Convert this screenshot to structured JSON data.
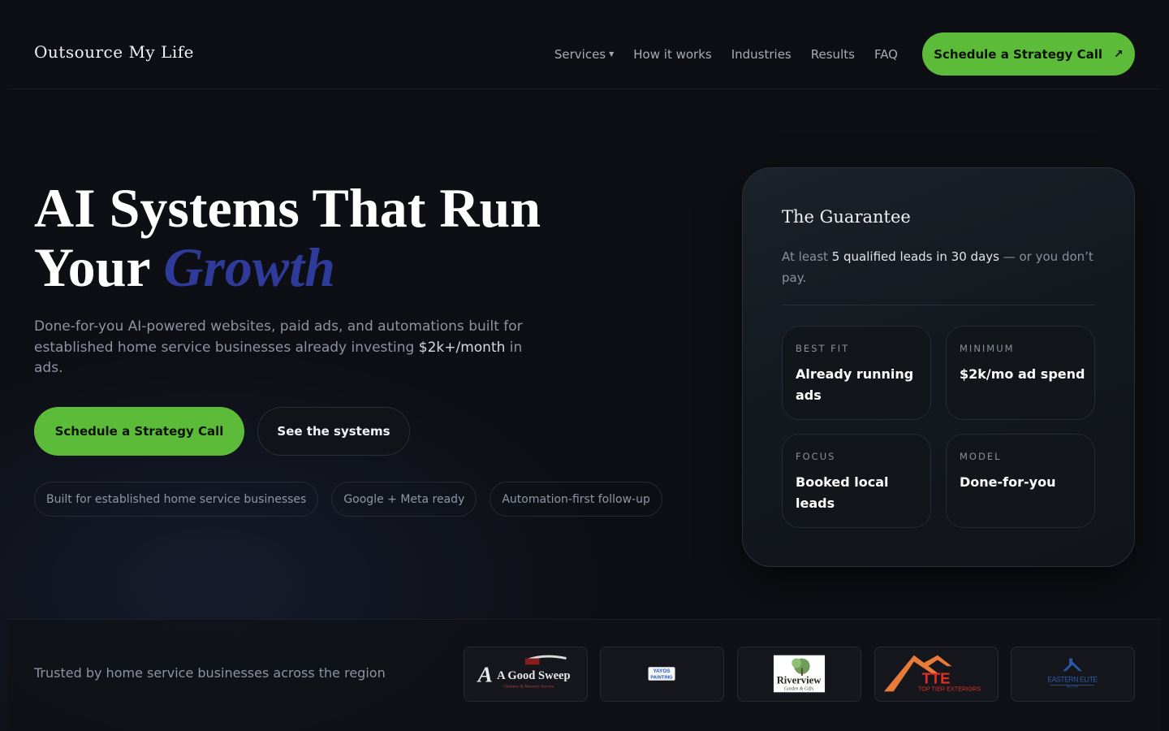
{
  "header": {
    "brand": "Outsource My Life",
    "nav": [
      {
        "label": "Services",
        "has_dropdown": true
      },
      {
        "label": "How it works"
      },
      {
        "label": "Industries"
      },
      {
        "label": "Results"
      },
      {
        "label": "FAQ"
      }
    ],
    "cta_label": "Schedule a Strategy Call",
    "cta_icon": "arrow-up-right-icon"
  },
  "hero": {
    "title_line1": "AI Systems That Run",
    "title_line2_plain": "Your",
    "title_line2_accent": "Growth",
    "subtitle_before": "Done-for-you AI-powered websites, paid ads, and automations built for established home service businesses already investing",
    "subtitle_highlight": "$2k+/month",
    "subtitle_after": "in ads.",
    "primary_cta": "Schedule a Strategy Call",
    "secondary_cta": "See the systems",
    "chips": [
      "Built for established home service businesses",
      "Google + Meta ready",
      "Automation-first follow-up"
    ]
  },
  "guarantee": {
    "title": "The Guarantee",
    "text_before": "At least",
    "text_highlight": "5 qualified leads in 30 days",
    "text_after": "— or you don’t pay.",
    "tiles": [
      {
        "label": "BEST FIT",
        "value": "Already running ads"
      },
      {
        "label": "MINIMUM",
        "value": "$2k/mo ad spend"
      },
      {
        "label": "FOCUS",
        "value": "Booked local leads"
      },
      {
        "label": "MODEL",
        "value": "Done-for-you"
      }
    ]
  },
  "trusted": {
    "text": "Trusted by home service businesses across the region",
    "logos": [
      {
        "name": "A Good Sweep",
        "tagline": "Chimney & Masonry Service"
      },
      {
        "name": "YAYOS PAINTING"
      },
      {
        "name": "Riverview",
        "tagline": "Garden & Gifts"
      },
      {
        "name": "TTE",
        "tagline": "TOP TIER EXTERIORS"
      },
      {
        "name": "EASTERN ELITE",
        "tagline": "WASH"
      }
    ]
  },
  "colors": {
    "accent_green": "#5cbc3a",
    "accent_blue": "#2f3b9a",
    "background": "#0d0f14"
  }
}
